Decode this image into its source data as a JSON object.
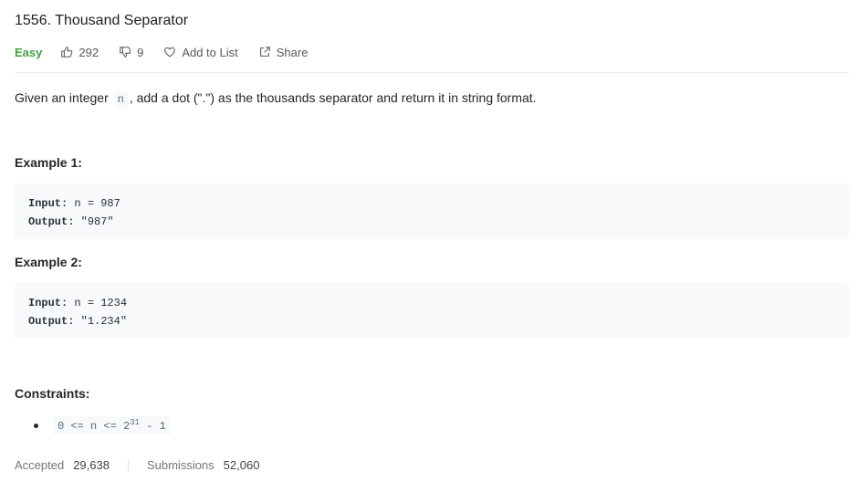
{
  "problem": {
    "title": "1556. Thousand Separator",
    "difficulty": "Easy",
    "likes": "292",
    "dislikes": "9",
    "add_to_list_label": "Add to List",
    "share_label": "Share"
  },
  "description": {
    "before": "Given an integer ",
    "code": "n",
    "after": ", add a dot (\".\") as the thousands separator and return it in string format."
  },
  "examples": [
    {
      "title": "Example 1:",
      "input_label": "Input:",
      "input_value": " n = 987",
      "output_label": "Output:",
      "output_value": " \"987\""
    },
    {
      "title": "Example 2:",
      "input_label": "Input:",
      "input_value": " n = 1234",
      "output_label": "Output:",
      "output_value": " \"1.234\""
    }
  ],
  "constraints": {
    "title": "Constraints:",
    "items": [
      {
        "prefix": "0 <= n <= 2",
        "superscript": "31",
        "suffix": " - 1"
      }
    ]
  },
  "stats": {
    "accepted_label": "Accepted",
    "accepted_value": "29,638",
    "submissions_label": "Submissions",
    "submissions_value": "52,060"
  },
  "colors": {
    "easy": "#43a047",
    "code_background": "#f7f9fa"
  }
}
